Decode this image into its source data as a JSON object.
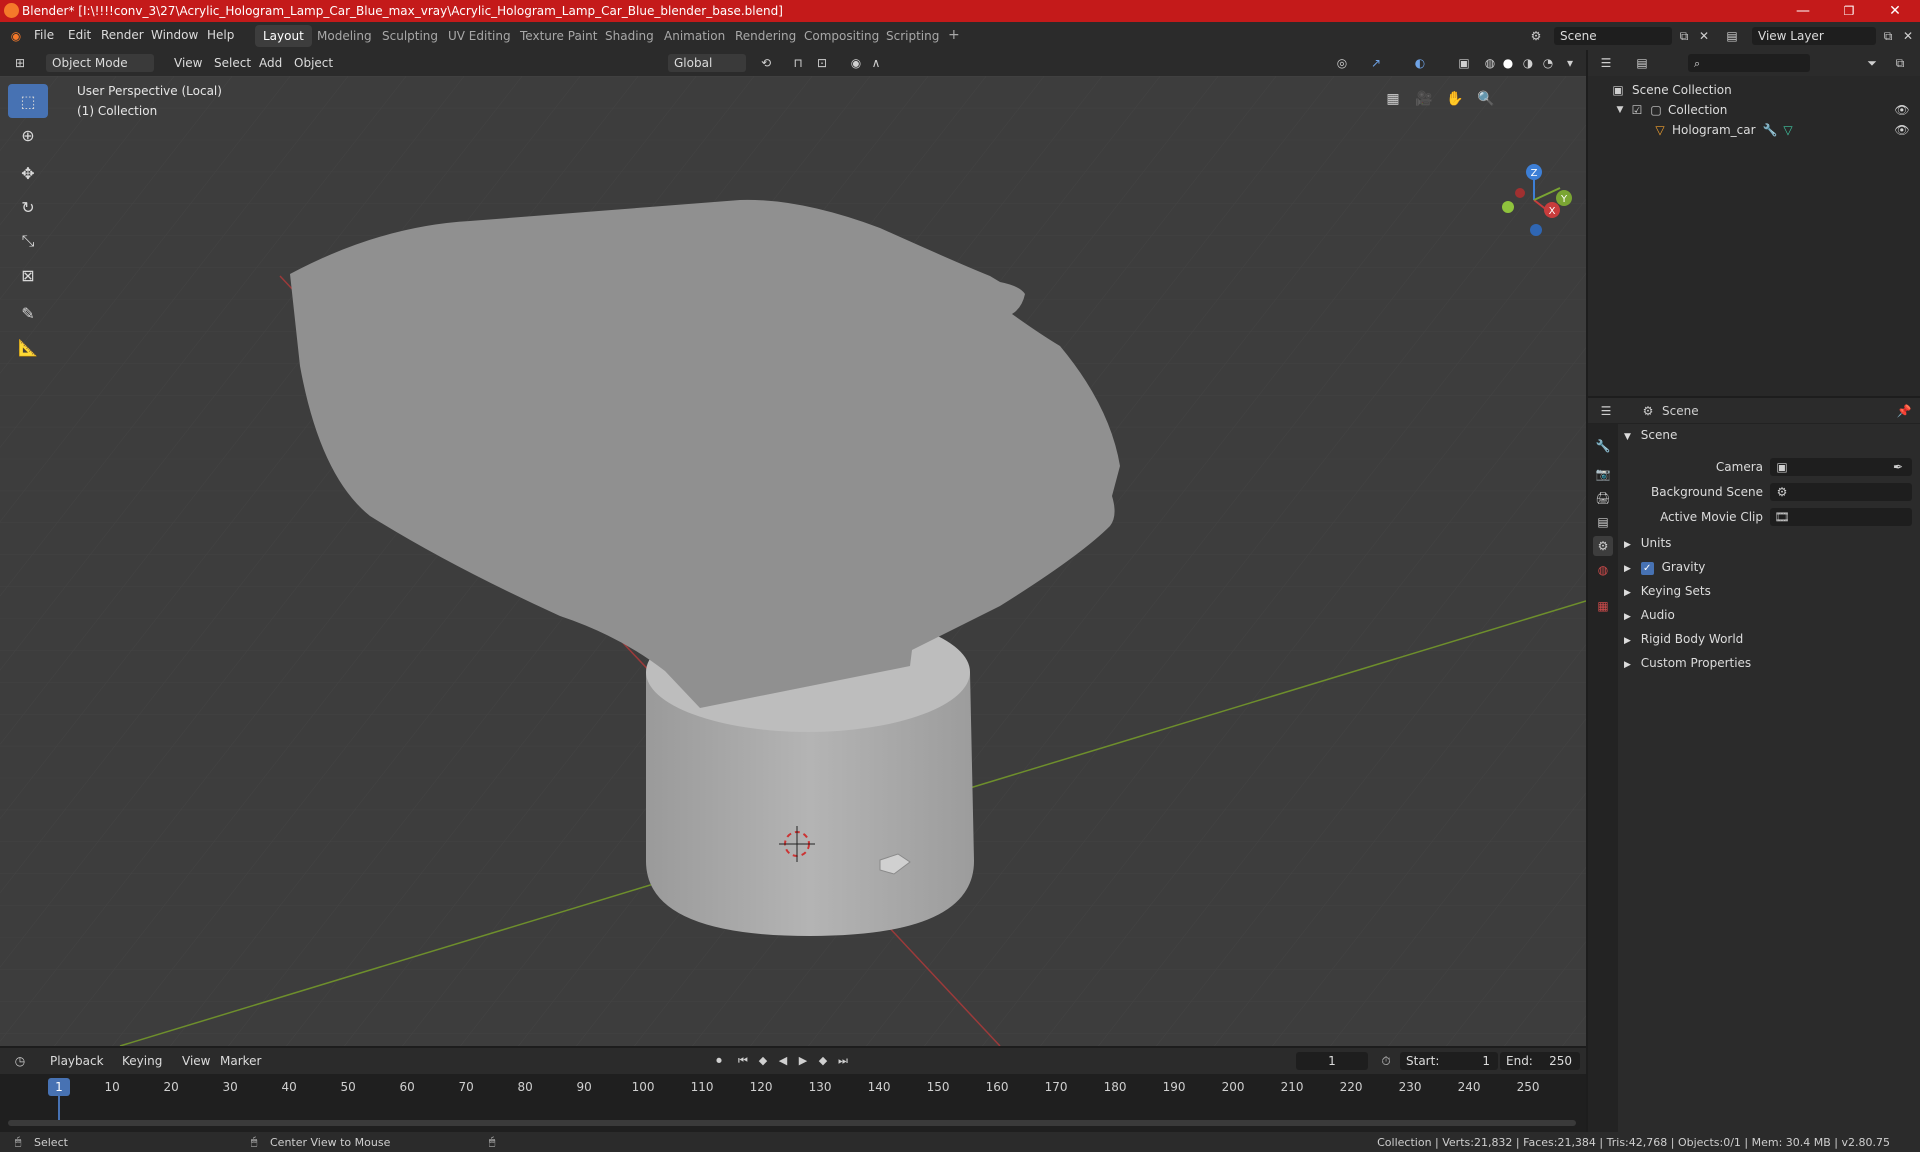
{
  "titlebar": {
    "title": "Blender* [I:\\!!!!conv_3\\27\\Acrylic_Hologram_Lamp_Car_Blue_max_vray\\Acrylic_Hologram_Lamp_Car_Blue_blender_base.blend]",
    "minimize": "—",
    "maximize": "❐",
    "close": "✕"
  },
  "menu": [
    "File",
    "Edit",
    "Render",
    "Window",
    "Help"
  ],
  "workspaces": [
    "Layout",
    "Modeling",
    "Sculpting",
    "UV Editing",
    "Texture Paint",
    "Shading",
    "Animation",
    "Rendering",
    "Compositing",
    "Scripting"
  ],
  "workspace_add": "+",
  "scene_field": "Scene",
  "view_layer_field": "View Layer",
  "viewport_header": {
    "mode": "Object Mode",
    "view": "View",
    "select": "Select",
    "add": "Add",
    "object": "Object",
    "transform_orientation": "Global"
  },
  "viewport": {
    "perspective": "User Perspective (Local)",
    "collection": "(1) Collection",
    "axis_x": "X",
    "axis_y": "Y",
    "axis_z": "Z"
  },
  "outliner": {
    "root": "Scene Collection",
    "collection": "Collection",
    "object": "Hologram_car"
  },
  "properties": {
    "header_title": "Scene",
    "section_scene": "Scene",
    "camera_label": "Camera",
    "background_label": "Background Scene",
    "movie_clip_label": "Active Movie Clip",
    "sections": [
      "Units",
      "Gravity",
      "Keying Sets",
      "Audio",
      "Rigid Body World",
      "Custom Properties"
    ]
  },
  "timeline": {
    "playback": "Playback",
    "keying": "Keying",
    "view": "View",
    "marker": "Marker",
    "current_frame": "1",
    "start_label": "Start:",
    "start_value": "1",
    "end_label": "End:",
    "end_value": "250",
    "ticks": [
      "1",
      "10",
      "20",
      "30",
      "40",
      "50",
      "60",
      "70",
      "80",
      "90",
      "100",
      "110",
      "120",
      "130",
      "140",
      "150",
      "160",
      "170",
      "180",
      "190",
      "200",
      "210",
      "220",
      "230",
      "240",
      "250"
    ]
  },
  "status": {
    "select": "Select",
    "center": "Center View to Mouse",
    "stats": "Collection | Verts:21,832 | Faces:21,384 | Tris:42,768 | Objects:0/1 | Mem: 30.4 MB | v2.80.75"
  },
  "colors": {
    "titlebar": "#c41a1a",
    "active_tool": "#4772b3",
    "viewport_bg": "#3d3d3d",
    "x_axis": "#c83c3c",
    "y_axis": "#7aa533",
    "z_axis": "#3d7fd6"
  }
}
